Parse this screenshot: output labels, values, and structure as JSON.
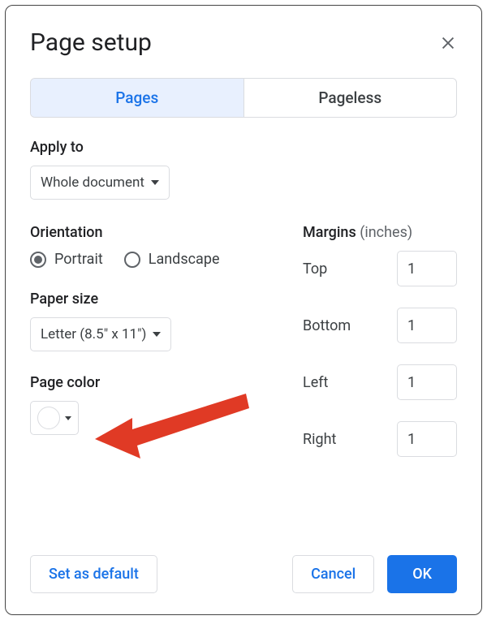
{
  "dialog": {
    "title": "Page setup"
  },
  "tabs": {
    "pages": "Pages",
    "pageless": "Pageless"
  },
  "apply_to": {
    "label": "Apply to",
    "value": "Whole document"
  },
  "orientation": {
    "label": "Orientation",
    "portrait": "Portrait",
    "landscape": "Landscape",
    "selected": "portrait"
  },
  "paper_size": {
    "label": "Paper size",
    "value": "Letter (8.5\" x 11\")"
  },
  "page_color": {
    "label": "Page color",
    "value": "#ffffff"
  },
  "margins": {
    "label": "Margins",
    "unit": "(inches)",
    "top": {
      "label": "Top",
      "value": "1"
    },
    "bottom": {
      "label": "Bottom",
      "value": "1"
    },
    "left": {
      "label": "Left",
      "value": "1"
    },
    "right": {
      "label": "Right",
      "value": "1"
    }
  },
  "footer": {
    "set_default": "Set as default",
    "cancel": "Cancel",
    "ok": "OK"
  }
}
